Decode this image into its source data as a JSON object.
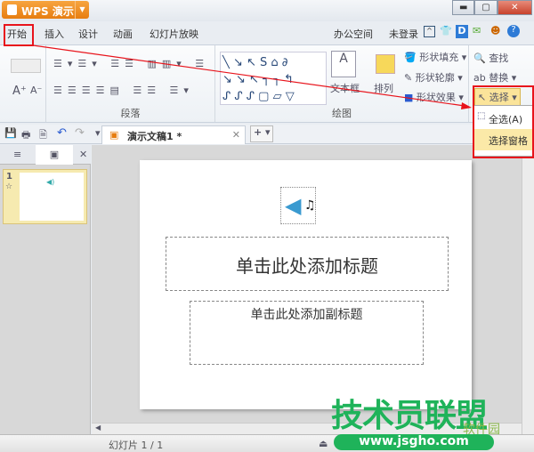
{
  "app": {
    "title": "WPS 演示"
  },
  "window_controls": [
    "minimize",
    "restore",
    "close"
  ],
  "tabs": [
    {
      "label": "开始",
      "active": true
    },
    {
      "label": "插入"
    },
    {
      "label": "设计"
    },
    {
      "label": "动画"
    },
    {
      "label": "幻灯片放映"
    }
  ],
  "header_right": {
    "office_space": "办公空间",
    "login": "未登录"
  },
  "ribbon": {
    "paragraph_group": "段落",
    "drawing_group": "绘图",
    "textbox": "文本框",
    "arrange": "排列",
    "shape_fill": "形状填充",
    "shape_outline": "形状轮廓",
    "shape_effect": "形状效果",
    "find": "查找",
    "replace": "替换",
    "select": "选择"
  },
  "select_menu": {
    "items": [
      "全选(A)",
      "选择窗格"
    ]
  },
  "document_tab": {
    "title": "演示文稿1 *"
  },
  "slide_panel": {
    "slide_number": "1"
  },
  "slide": {
    "title_placeholder": "单击此处添加标题",
    "subtitle_placeholder": "单击此处添加副标题"
  },
  "status": {
    "slide_counter": "幻灯片 1 / 1"
  },
  "watermark": {
    "title": "技术员联盟",
    "url": "www.jsgho.com",
    "sub": "软件园"
  },
  "colors": {
    "accent": "#e77d10",
    "highlight": "#e8141c",
    "watermark": "#1fb35a"
  }
}
